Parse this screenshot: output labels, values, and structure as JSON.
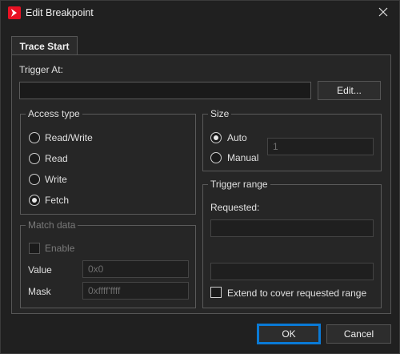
{
  "window": {
    "title": "Edit Breakpoint"
  },
  "tab": {
    "label": "Trace Start"
  },
  "trigger": {
    "label": "Trigger At:",
    "value": "",
    "edit_label": "Edit..."
  },
  "access_type": {
    "title": "Access type",
    "options": [
      {
        "label": "Read/Write",
        "checked": false
      },
      {
        "label": "Read",
        "checked": false
      },
      {
        "label": "Write",
        "checked": false
      },
      {
        "label": "Fetch",
        "checked": true
      }
    ]
  },
  "size": {
    "title": "Size",
    "auto_label": "Auto",
    "manual_label": "Manual",
    "manual_value": "1"
  },
  "match_data": {
    "title": "Match data",
    "enable_label": "Enable",
    "value_label": "Value",
    "value_placeholder": "0x0",
    "mask_label": "Mask",
    "mask_placeholder": "0xffff'ffff"
  },
  "trigger_range": {
    "title": "Trigger range",
    "requested_label": "Requested:",
    "requested_value": "",
    "second_value": "",
    "extend_label": "Extend to cover requested range"
  },
  "footer": {
    "ok_label": "OK",
    "cancel_label": "Cancel"
  },
  "colors": {
    "accent": "#0a7ad6",
    "app_icon": "#e81123"
  }
}
